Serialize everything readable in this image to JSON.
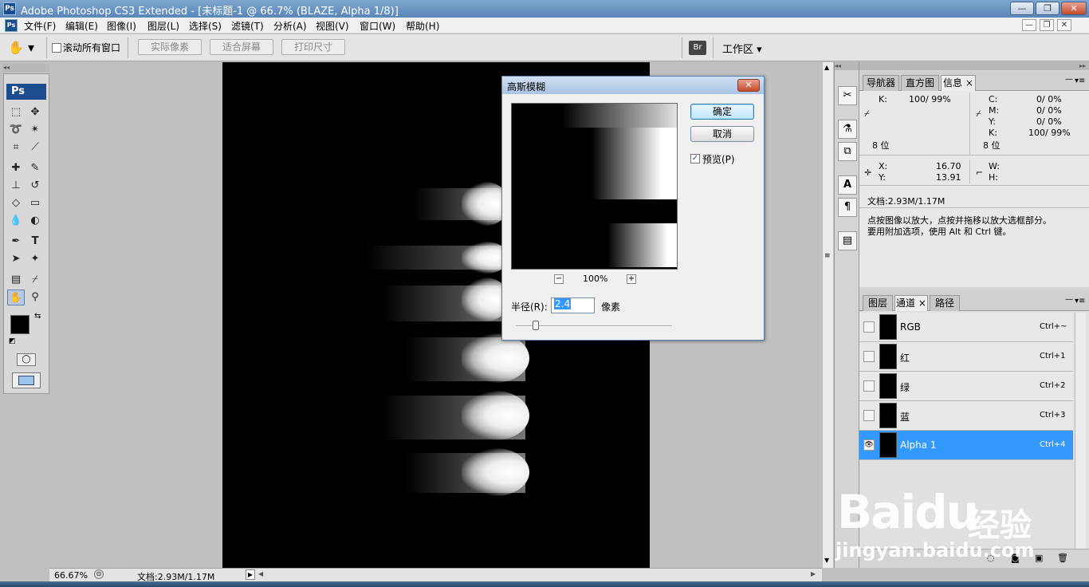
{
  "window": {
    "title": "Adobe Photoshop CS3 Extended - [未标题-1 @ 66.7% (BLAZE, Alpha 1/8)]",
    "logo": "Ps",
    "minimize": "—",
    "maximize": "❐",
    "close": "✕"
  },
  "menu": {
    "logo": "Ps",
    "items": [
      "文件(F)",
      "编辑(E)",
      "图像(I)",
      "图层(L)",
      "选择(S)",
      "滤镜(T)",
      "分析(A)",
      "视图(V)",
      "窗口(W)",
      "帮助(H)"
    ]
  },
  "options": {
    "scroll_all_label": "滚动所有窗口",
    "actual_pixels": "实际像素",
    "fit_screen": "适合屏幕",
    "print_size": "打印尺寸",
    "workspace": "工作区 ▾",
    "bridge_icon": "Br"
  },
  "toolbox": {
    "badge": "Ps"
  },
  "dialog": {
    "title": "高斯模糊",
    "ok": "确定",
    "cancel": "取消",
    "preview_label": "预览(P)",
    "preview_checked": "✓",
    "zoom_level": "100%",
    "zoom_out": "−",
    "zoom_in": "+",
    "radius_label": "半径(R):",
    "radius_value": "2.4",
    "radius_unit": "像素",
    "close": "✕"
  },
  "status": {
    "zoom": "66.67%",
    "doc": "文档:2.93M/1.17M"
  },
  "info_panel": {
    "tabs": [
      "导航器",
      "直方图",
      "信息"
    ],
    "active_tab": "信息",
    "k_label": "K:",
    "k_value": "100/  99%",
    "c_label": "C:",
    "c_value": "0/   0%",
    "m_label": "M:",
    "m_value": "0/   0%",
    "y_label": "Y:",
    "y_value": "0/   0%",
    "k2_label": "K:",
    "k2_value": "100/  99%",
    "bit_left": "8 位",
    "bit_right": "8 位",
    "x_label": "X:",
    "x_value": "16.70",
    "y_coord_label": "Y:",
    "y_coord_value": "13.91",
    "w_label": "W:",
    "h_label": "H:",
    "doc": "文档:2.93M/1.17M",
    "hint_line1": "点按图像以放大，点按并拖移以放大选框部分。",
    "hint_line2": "要用附加选项，使用 Alt 和 Ctrl 键。"
  },
  "channels_panel": {
    "tabs": [
      "图层",
      "通道",
      "路径"
    ],
    "active_tab": "通道",
    "rows": [
      {
        "name": "RGB",
        "key": "Ctrl+~"
      },
      {
        "name": "红",
        "key": "Ctrl+1"
      },
      {
        "name": "绿",
        "key": "Ctrl+2"
      },
      {
        "name": "蓝",
        "key": "Ctrl+3"
      },
      {
        "name": "Alpha 1",
        "key": "Ctrl+4"
      }
    ],
    "eye_icon": "👁"
  },
  "watermark": {
    "brand": "Bai",
    "brand_paw": "du",
    "cn": "经验",
    "url": "jingyan.baidu.com"
  }
}
